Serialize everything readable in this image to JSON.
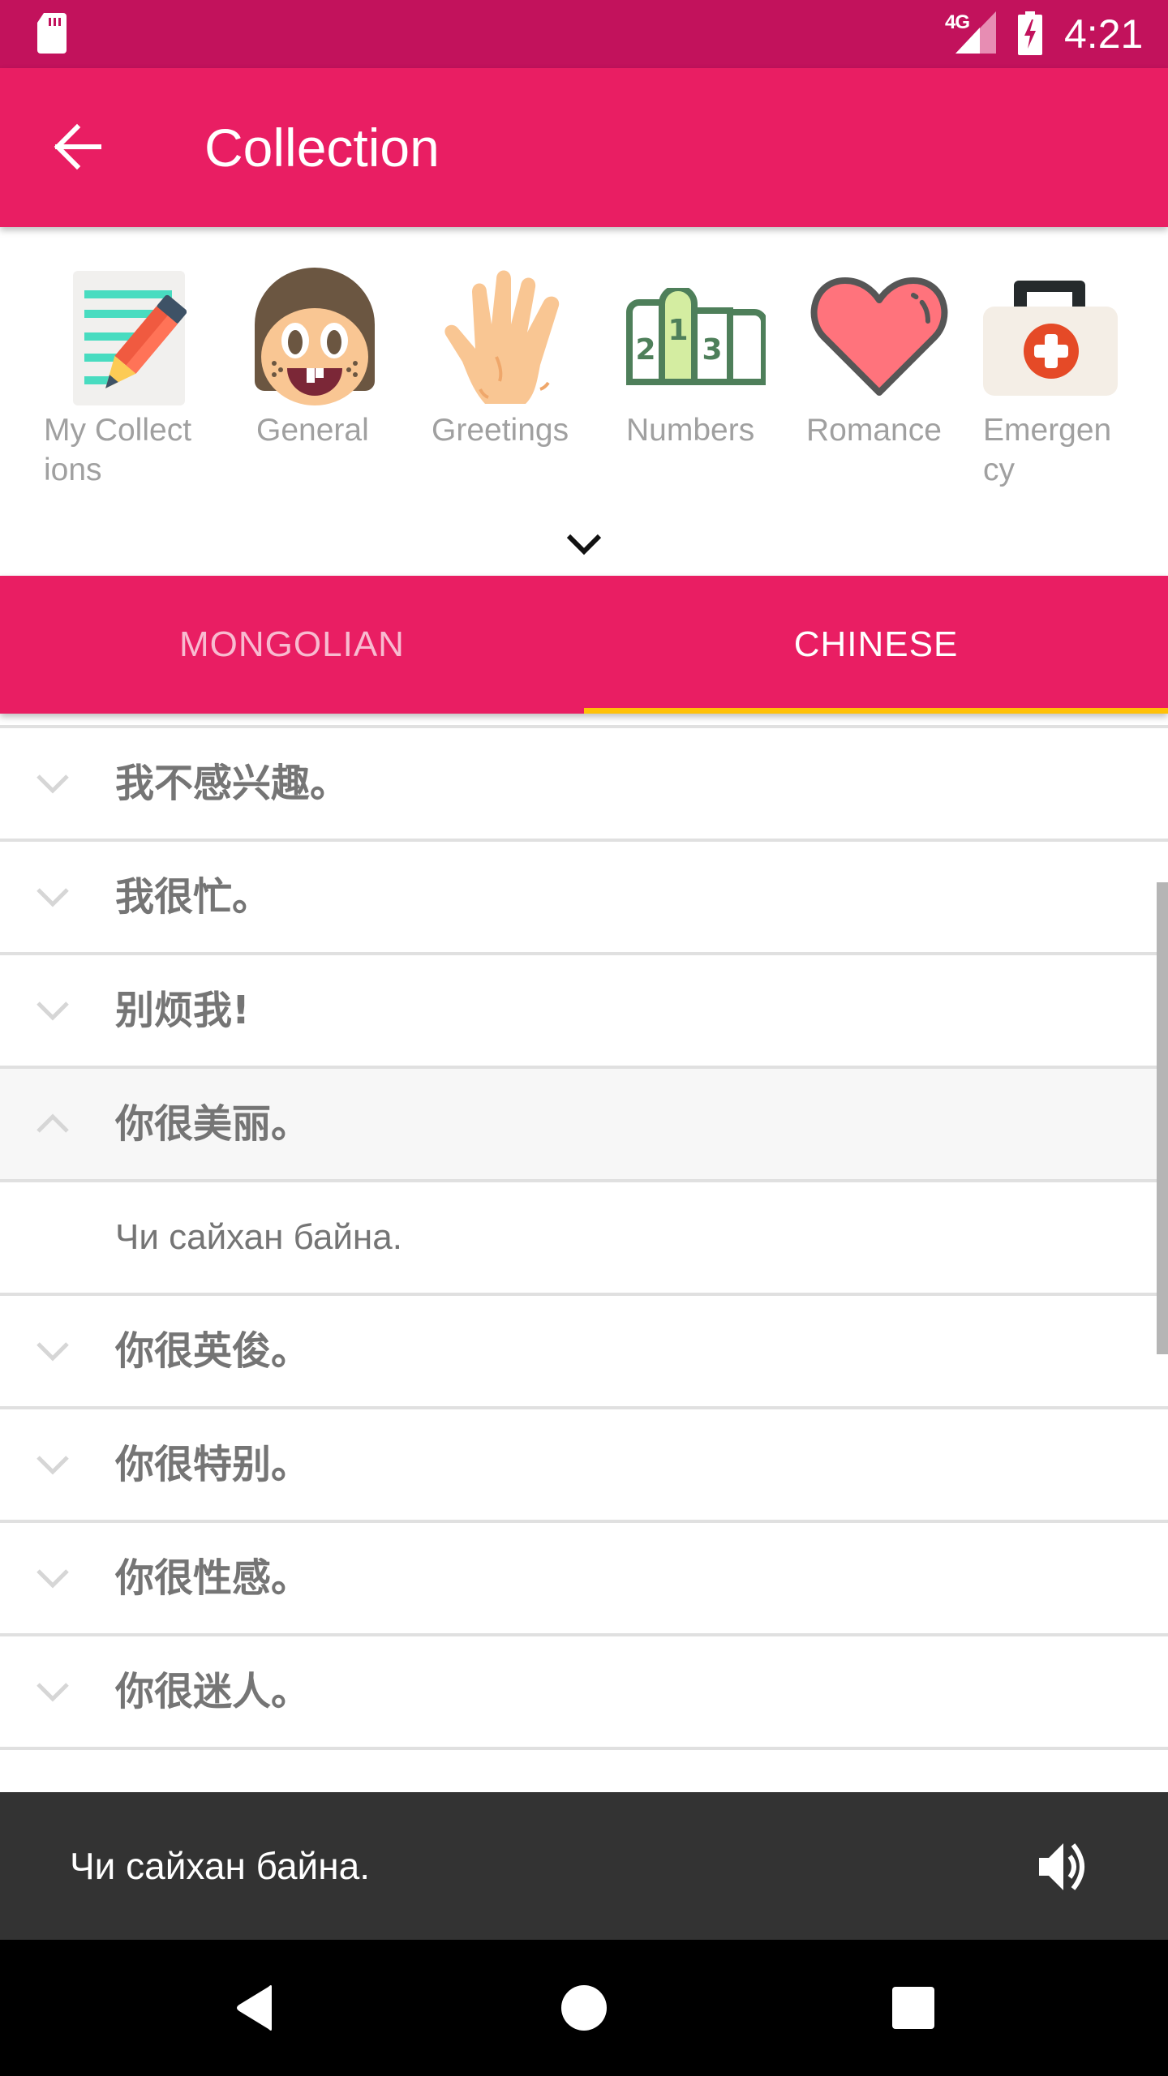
{
  "status_bar": {
    "network": "4G",
    "time": "4:21",
    "icons": [
      "sd-card-icon",
      "signal-icon",
      "battery-charging-icon"
    ]
  },
  "app_bar": {
    "back_icon": "arrow-back-icon",
    "title": "Collection"
  },
  "categories": [
    {
      "label": "My Collect\nions",
      "icon": "notepad-pencil-icon"
    },
    {
      "label": "General",
      "icon": "face-icon"
    },
    {
      "label": "Greetings",
      "icon": "hand-wave-icon"
    },
    {
      "label": "Numbers",
      "icon": "podium-icon"
    },
    {
      "label": "Romance",
      "icon": "heart-icon"
    },
    {
      "label": "Emergen\ncy",
      "icon": "first-aid-kit-icon"
    }
  ],
  "expand_icon": "chevron-down-icon",
  "tabs": [
    {
      "label": "MONGOLIAN",
      "selected": false
    },
    {
      "label": "CHINESE",
      "selected": true
    }
  ],
  "colors": {
    "status_bar": "#C2125C",
    "primary": "#E91E63",
    "tab_indicator": "#FFC107",
    "snackbar": "#333333"
  },
  "phrases": [
    {
      "text": "我不感兴趣。",
      "expanded": false
    },
    {
      "text": "我很忙。",
      "expanded": false
    },
    {
      "text": "别烦我!",
      "expanded": false
    },
    {
      "text": "你很美丽。",
      "expanded": true,
      "translation": "Чи сайхан байна."
    },
    {
      "text": "你很英俊。",
      "expanded": false
    },
    {
      "text": "你很特别。",
      "expanded": false
    },
    {
      "text": "你很性感。",
      "expanded": false
    },
    {
      "text": "你很迷人。",
      "expanded": false
    }
  ],
  "snackbar": {
    "text": "Чи сайхан байна.",
    "icon": "volume-up-icon"
  },
  "nav_bar": {
    "buttons": [
      "back-triangle-icon",
      "home-circle-icon",
      "recents-square-icon"
    ]
  }
}
